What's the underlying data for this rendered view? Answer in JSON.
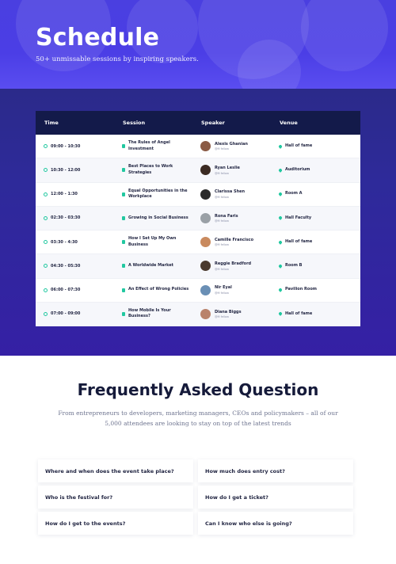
{
  "hero": {
    "title": "Schedule",
    "subtitle": "50+ unmissable sessions by inspiring speakers."
  },
  "schedule": {
    "headers": [
      "Time",
      "Session",
      "Speaker",
      "Venue"
    ],
    "rows": [
      {
        "time": "09:00 - 10:30",
        "session": "The Rules of Angel Investment",
        "speaker": "Alexis Ghanian",
        "role": "@M fellow",
        "venue": "Hall of fame",
        "avatar_color": "#8a5a44"
      },
      {
        "time": "10:30 - 12:00",
        "session": "Best Places to Work Strategies",
        "speaker": "Ryan Leslie",
        "role": "@M fellow",
        "venue": "Auditorium",
        "avatar_color": "#3b2a22"
      },
      {
        "time": "12:00 - 1:30",
        "session": "Equal Opportunities in the Workplace",
        "speaker": "Clarissa Shen",
        "role": "@M fellow",
        "venue": "Room A",
        "avatar_color": "#2a2a2a"
      },
      {
        "time": "02:30 - 03:30",
        "session": "Growing in Social Business",
        "speaker": "Rona Faris",
        "role": "@M fellow",
        "venue": "Hall Faculty",
        "avatar_color": "#9aa0a6"
      },
      {
        "time": "03:30 - 4:30",
        "session": "How I Set Up My Own Business",
        "speaker": "Camille Francisco",
        "role": "@M fellow",
        "venue": "Hall of fame",
        "avatar_color": "#c98a5e"
      },
      {
        "time": "04:30 - 05:30",
        "session": "A Worldwide Market",
        "speaker": "Reggie Bradford",
        "role": "@M fellow",
        "venue": "Room B",
        "avatar_color": "#4a3a2e"
      },
      {
        "time": "06:00 - 07:30",
        "session": "An Effect of Wrong Policies",
        "speaker": "Nir Eyal",
        "role": "@M fellow",
        "venue": "Pavilion Room",
        "avatar_color": "#6a8fb5"
      },
      {
        "time": "07:00 - 09:00",
        "session": "How Mobile Is Your Business?",
        "speaker": "Diana Biggs",
        "role": "@M fellow",
        "venue": "Hall of fame",
        "avatar_color": "#b9826b"
      }
    ]
  },
  "faq": {
    "title": "Frequently Asked Question",
    "subtitle_line1": "From entrepreneurs to developers, marketing managers, CEOs and policymakers – all of our",
    "subtitle_line2": "5,000 attendees are looking to stay on top of the latest trends",
    "questions": [
      "Where and when does the event take place?",
      "How much does entry cost?",
      "Who is the festival for?",
      "How do I get a ticket?",
      "How do I get to the events?",
      "Can I know who else is going?"
    ]
  },
  "colors": {
    "accent": "#21c8a0",
    "hero": "#4a3fe0",
    "band": "#2e2a9a",
    "table_header": "#131a4a"
  },
  "icons": {
    "time": "clock-icon",
    "session": "document-icon",
    "venue": "location-pin-icon"
  }
}
